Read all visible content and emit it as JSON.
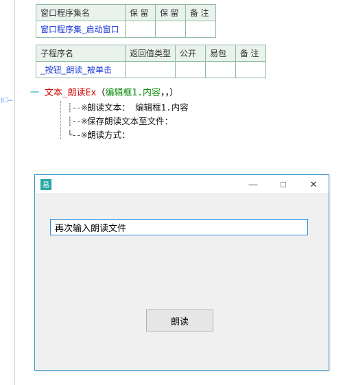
{
  "gutter_mark": "↕□–",
  "table1": {
    "headers": [
      "窗口程序集名",
      "保 留",
      "保 留",
      "备 注"
    ],
    "row": [
      "窗口程序集_启动窗口",
      "",
      "",
      ""
    ]
  },
  "table2": {
    "headers": [
      "子程序名",
      "返回值类型",
      "公开",
      "易包",
      "备 注"
    ],
    "row": [
      "_按钮_朗读_被单击",
      "",
      "",
      "",
      ""
    ]
  },
  "code": {
    "line1_prefix": "一  ",
    "func": "文本_朗读Ex",
    "args_open": "（",
    "arg": "编辑框1.内容",
    "args_rest": "，，）",
    "p1_marker": "┊--※",
    "p1_label": "朗读文本：  ",
    "p1_val": "编辑框1.内容",
    "p2_marker": "┊--※",
    "p2_label": "保存朗读文本至文件：",
    "p3_marker": "└--※",
    "p3_label": "朗读方式："
  },
  "window": {
    "icon_glyph": "易",
    "input_value": "再次输入朗读文件",
    "button_label": "朗读",
    "minimize": "—",
    "maximize": "□",
    "close": "✕"
  }
}
